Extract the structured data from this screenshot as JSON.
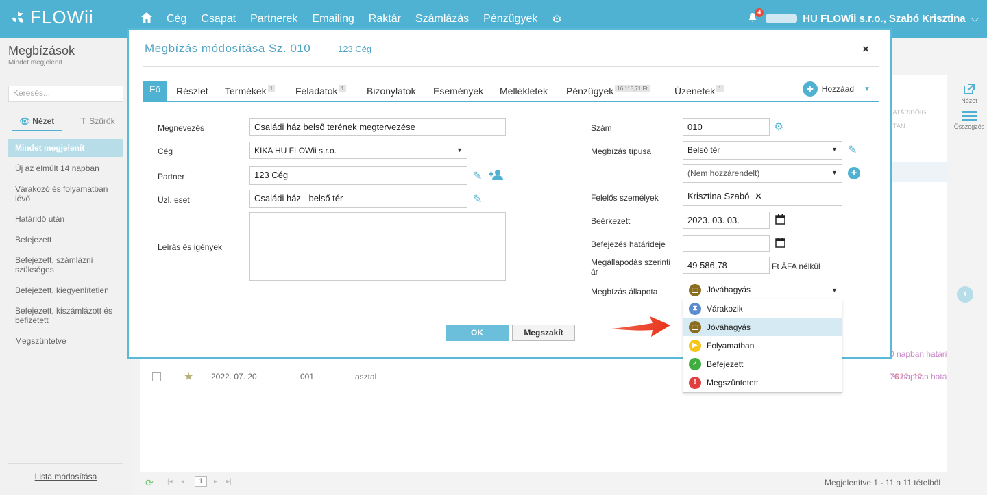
{
  "topbar": {
    "logo": "FLOWii",
    "nav": [
      "Cég",
      "Csapat",
      "Partnerek",
      "Emailing",
      "Raktár",
      "Számlázás",
      "Pénzügyek"
    ],
    "notifications": "4",
    "user": "HU FLOWii s.r.o., Szabó Krisztina"
  },
  "sidebar": {
    "title": "Megbízások",
    "subtitle": "Mindet megjelenít",
    "search_placeholder": "Keresés...",
    "view_tab": "Nézet",
    "filter_tab": "Szűrők",
    "items": [
      "Mindet megjelenít",
      "Új az elmúlt 14 napban",
      "Várakozó és folyamatban lévő",
      "Határidő után",
      "Befejezett",
      "Befejezett, számlázni szükséges",
      "Befejezett, kiegyenlítetlen",
      "Befejezett, kiszámlázott és befizetett",
      "Megszüntetve"
    ],
    "footer": "Lista módosítása"
  },
  "background": {
    "col_header_1": "HATÁRIDŐIG",
    "col_header_2": "UTÁN",
    "row_date": "2022. 07. 20.",
    "row_num": "001",
    "row_name": "asztal",
    "row_date2": "2022. 12.",
    "row_due": "76 napban hatá",
    "row_due_prev": "0 napban határi",
    "pager_page": "1",
    "status": "Megjelenítve 1 - 11 a 11 tételből"
  },
  "rightside": {
    "view": "Nézet",
    "summary": "Összegzés"
  },
  "modal": {
    "title": "Megbízás módosítása Sz. 010",
    "link": "123 Cég",
    "close": "×",
    "tabs": [
      {
        "label": "Fő"
      },
      {
        "label": "Részlet"
      },
      {
        "label": "Termékek",
        "count": "1"
      },
      {
        "label": "Feladatok",
        "count": "1"
      },
      {
        "label": "Bizonylatok"
      },
      {
        "label": "Események"
      },
      {
        "label": "Mellékletek"
      },
      {
        "label": "Pénzügyek",
        "count": "16 115,71 Ft"
      },
      {
        "label": "Üzenetek",
        "count": "1"
      }
    ],
    "add_label": "Hozzáad",
    "left": {
      "name_label": "Megnevezés",
      "name_value": "Családi ház belső terének megtervezése",
      "company_label": "Cég",
      "company_value": "KIKA HU FLOWii s.r.o.",
      "partner_label": "Partner",
      "partner_value": "123  Cég",
      "case_label": "Üzl. eset",
      "case_value": "Családi ház - belső tér",
      "desc_label": "Leírás és igények"
    },
    "right": {
      "number_label": "Szám",
      "number_value": "010",
      "type_label": "Megbízás típusa",
      "type_value": "Belső tér",
      "unassigned_value": "(Nem hozzárendelt)",
      "responsible_label": "Felelős személyek",
      "responsible_value": "Krisztina Szabó",
      "received_label": "Beérkezett",
      "received_value": "2023. 03. 03.",
      "deadline_label": "Befejezés határideje",
      "deadline_value": "",
      "price_label": "Megállapodás szerinti ár",
      "price_value": "49 586,78",
      "price_suffix": "Ft ÁFA nélkül",
      "status_label": "Megbízás állapota",
      "status_value": "Jóváhagyás"
    },
    "ok": "OK",
    "cancel": "Megszakít",
    "status_options": [
      {
        "label": "Várakozik",
        "color": "#5b8ccf",
        "icon": "hourglass-icon"
      },
      {
        "label": "Jóváhagyás",
        "color": "#8a6d1f",
        "icon": "approval-icon"
      },
      {
        "label": "Folyamatban",
        "color": "#f5c518",
        "icon": "play-icon"
      },
      {
        "label": "Befejezett",
        "color": "#3fae3f",
        "icon": "check-icon"
      },
      {
        "label": "Megszüntetett",
        "color": "#e04040",
        "icon": "exclamation-icon"
      }
    ]
  }
}
